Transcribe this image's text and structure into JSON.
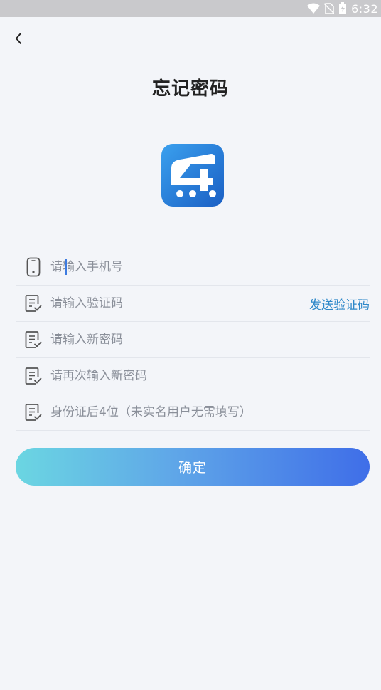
{
  "status_bar": {
    "time": "6:32",
    "icons": [
      "wifi-icon",
      "no-sim-icon",
      "battery-charging-icon"
    ]
  },
  "header": {
    "back_icon": "chevron-left-icon",
    "title": "忘记密码"
  },
  "logo": {
    "icon": "app-logo",
    "brand_colors": [
      "#2a8de6",
      "#1a5fc4"
    ]
  },
  "form": {
    "phone": {
      "placeholder": "请输入手机号",
      "value": "",
      "icon": "phone-icon"
    },
    "code": {
      "placeholder": "请输入验证码",
      "value": "",
      "icon": "document-check-icon",
      "send_label": "发送验证码"
    },
    "new_password": {
      "placeholder": "请输入新密码",
      "value": "",
      "icon": "document-check-icon"
    },
    "confirm_password": {
      "placeholder": "请再次输入新密码",
      "value": "",
      "icon": "document-check-icon"
    },
    "id_suffix": {
      "placeholder": "身份证后4位（未实名用户无需填写）",
      "value": "",
      "icon": "document-check-icon"
    }
  },
  "actions": {
    "confirm_label": "确定",
    "accent": "#2e88c9"
  }
}
